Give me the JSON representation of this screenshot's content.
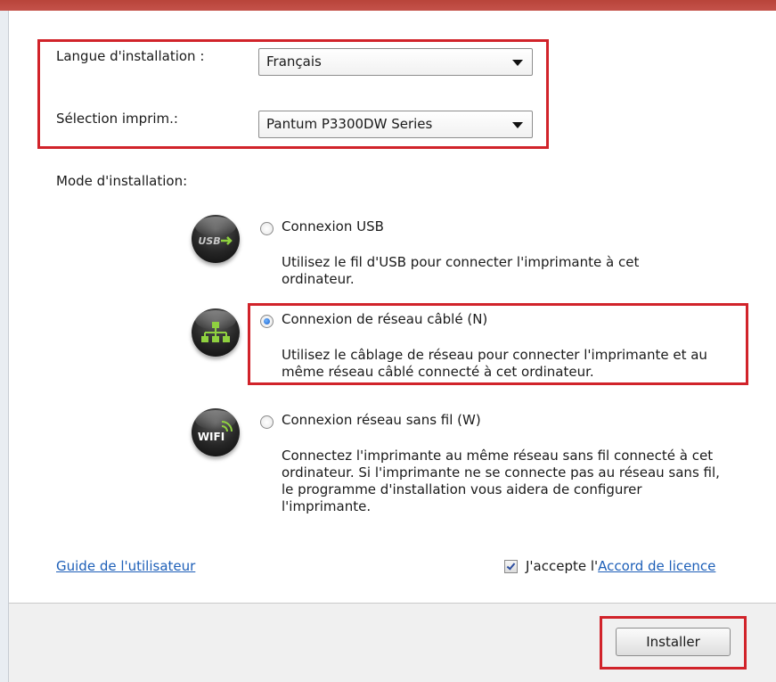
{
  "form": {
    "language_label": "Langue d'installation :",
    "language_value": "Français",
    "printer_label": "Sélection imprim.:",
    "printer_value": "Pantum P3300DW Series",
    "mode_label": "Mode d'installation:"
  },
  "modes": [
    {
      "icon": "usb-icon",
      "label": "Connexion USB",
      "description": "Utilisez le fil d'USB pour connecter l'imprimante à cet ordinateur.",
      "selected": false
    },
    {
      "icon": "network-icon",
      "label": "Connexion de réseau câblé (N)",
      "description": "Utilisez le câblage de réseau pour connecter l'imprimante et au même réseau câblé connecté à cet ordinateur.",
      "selected": true
    },
    {
      "icon": "wifi-icon",
      "label": "Connexion réseau sans fil (W)",
      "description": "Connectez l'imprimante au même réseau sans fil connecté à cet ordinateur. Si l'imprimante ne se connecte pas au réseau sans fil, le programme d'installation vous aidera de configurer l'imprimante.",
      "selected": false
    }
  ],
  "bottom": {
    "guide_link": "Guide de l'utilisateur",
    "accept_prefix": "J'accepte l'",
    "license_link": "Accord de licence",
    "accept_checked": true
  },
  "footer": {
    "install_label": "Installer"
  },
  "icon_text": {
    "usb": "USB",
    "wifi": "WIFI"
  },
  "colors": {
    "highlight": "#d1232a",
    "link": "#1d5fb8",
    "window_top_bar": "#b8443a"
  }
}
